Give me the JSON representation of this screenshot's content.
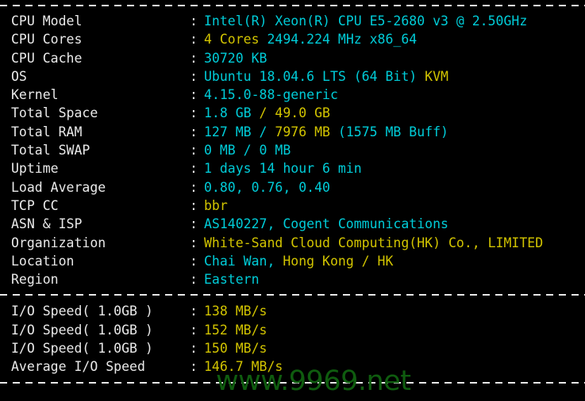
{
  "terminal": {
    "background": "#000000",
    "colors": {
      "label": "#e9e9e9",
      "cyan": "#00ccd8",
      "yellow": "#d2c400",
      "separator": "#e8e8e8",
      "watermark": "#0f5c0f"
    },
    "separator_char": "-",
    "colon": ":"
  },
  "system_info": {
    "rows": [
      {
        "label": "CPU Model",
        "value": "Intel(R) Xeon(R) CPU E5-2680 v3 @ 2.50GHz",
        "segments": [
          {
            "text": "Intel(R) Xeon(R) CPU E5-2680 v3 @ 2.50GHz",
            "color": "cyan"
          }
        ]
      },
      {
        "label": "CPU Cores",
        "value": "4 Cores 2494.224 MHz x86_64",
        "segments": [
          {
            "text": "4 Cores ",
            "color": "yellow"
          },
          {
            "text": "2494.224 MHz x86_64",
            "color": "cyan"
          }
        ]
      },
      {
        "label": "CPU Cache",
        "value": "30720 KB",
        "segments": [
          {
            "text": "30720 KB",
            "color": "cyan"
          }
        ]
      },
      {
        "label": "OS",
        "value": "Ubuntu 18.04.6 LTS (64 Bit) KVM",
        "segments": [
          {
            "text": "Ubuntu 18.04.6 LTS (64 Bit) ",
            "color": "cyan"
          },
          {
            "text": "KVM",
            "color": "yellow"
          }
        ]
      },
      {
        "label": "Kernel",
        "value": "4.15.0-88-generic",
        "segments": [
          {
            "text": "4.15.0-88-generic",
            "color": "cyan"
          }
        ]
      },
      {
        "label": "Total Space",
        "value": "1.8 GB / 49.0 GB",
        "segments": [
          {
            "text": "1.8 GB ",
            "color": "cyan"
          },
          {
            "text": "/ 49.0 GB",
            "color": "yellow"
          }
        ]
      },
      {
        "label": "Total RAM",
        "value": "127 MB / 7976 MB (1575 MB Buff)",
        "segments": [
          {
            "text": "127 MB / ",
            "color": "cyan"
          },
          {
            "text": "7976 MB",
            "color": "yellow"
          },
          {
            "text": " (1575 MB Buff)",
            "color": "cyan"
          }
        ]
      },
      {
        "label": "Total SWAP",
        "value": "0 MB / 0 MB",
        "segments": [
          {
            "text": "0 MB / 0 MB",
            "color": "cyan"
          }
        ]
      },
      {
        "label": "Uptime",
        "value": "1 days 14 hour 6 min",
        "segments": [
          {
            "text": "1 days 14 hour 6 min",
            "color": "cyan"
          }
        ]
      },
      {
        "label": "Load Average",
        "value": "0.80, 0.76, 0.40",
        "segments": [
          {
            "text": "0.80, 0.76, 0.40",
            "color": "cyan"
          }
        ]
      },
      {
        "label": "TCP CC",
        "value": "bbr",
        "segments": [
          {
            "text": "bbr",
            "color": "yellow"
          }
        ]
      },
      {
        "label": "ASN & ISP",
        "value": "AS140227, Cogent Communications",
        "segments": [
          {
            "text": "AS140227, Cogent Communications",
            "color": "cyan"
          }
        ]
      },
      {
        "label": "Organization",
        "value": "White-Sand Cloud Computing(HK) Co., LIMITED",
        "segments": [
          {
            "text": "White-Sand Cloud Computing(HK) Co., LIMITED",
            "color": "yellow"
          }
        ]
      },
      {
        "label": "Location",
        "value": "Chai Wan, Hong Kong / HK",
        "segments": [
          {
            "text": "Chai Wan, ",
            "color": "cyan"
          },
          {
            "text": "Hong Kong / HK",
            "color": "yellow"
          }
        ]
      },
      {
        "label": "Region",
        "value": "Eastern",
        "segments": [
          {
            "text": "Eastern",
            "color": "cyan"
          }
        ]
      }
    ]
  },
  "io_test": {
    "rows": [
      {
        "label": "I/O Speed( 1.0GB )",
        "value": "138 MB/s",
        "segments": [
          {
            "text": "138 MB/s",
            "color": "yellow"
          }
        ]
      },
      {
        "label": "I/O Speed( 1.0GB )",
        "value": "152 MB/s",
        "segments": [
          {
            "text": "152 MB/s",
            "color": "yellow"
          }
        ]
      },
      {
        "label": "I/O Speed( 1.0GB )",
        "value": "150 MB/s",
        "segments": [
          {
            "text": "150 MB/s",
            "color": "yellow"
          }
        ]
      },
      {
        "label": "Average I/O Speed",
        "value": "146.7 MB/s",
        "segments": [
          {
            "text": "146.7 MB/s",
            "color": "yellow"
          }
        ]
      }
    ]
  },
  "watermark": {
    "text": "www.9969.net"
  }
}
